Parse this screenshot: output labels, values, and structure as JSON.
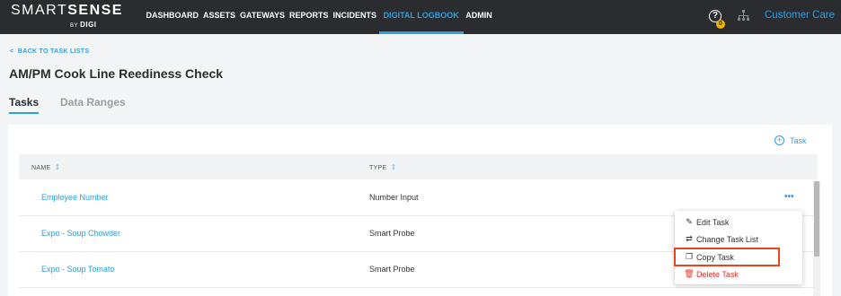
{
  "brand": {
    "name_light": "SMART",
    "name_bold": "SENSE",
    "by": "BY",
    "by_brand": "DIGI"
  },
  "nav": {
    "items": [
      "DASHBOARD",
      "ASSETS",
      "GATEWAYS",
      "REPORTS",
      "INCIDENTS",
      "DIGITAL LOGBOOK",
      "ADMIN"
    ],
    "active": "DIGITAL LOGBOOK",
    "help_badge": "0",
    "customer_care": "Customer Care"
  },
  "page": {
    "back_link": "BACK TO TASK LISTS",
    "title": "AM/PM Cook Line Reediness Check",
    "tabs": [
      "Tasks",
      "Data Ranges"
    ],
    "active_tab": "Tasks"
  },
  "table": {
    "add_label": "Task",
    "columns": [
      "NAME",
      "TYPE"
    ],
    "rows": [
      {
        "name": "Employee Number",
        "type": "Number Input"
      },
      {
        "name": "Expo - Soup Chowder",
        "type": "Smart Probe"
      },
      {
        "name": "Expo - Soup Tomato",
        "type": "Smart Probe"
      }
    ]
  },
  "context_menu": {
    "items": [
      "Edit Task",
      "Change Task List",
      "Copy Task",
      "Delete Task"
    ],
    "highlighted": "Copy Task"
  },
  "colors": {
    "accent": "#2d9ee0",
    "topbar": "#2a2c30",
    "danger": "#e0332e",
    "highlight": "#e8461f"
  }
}
